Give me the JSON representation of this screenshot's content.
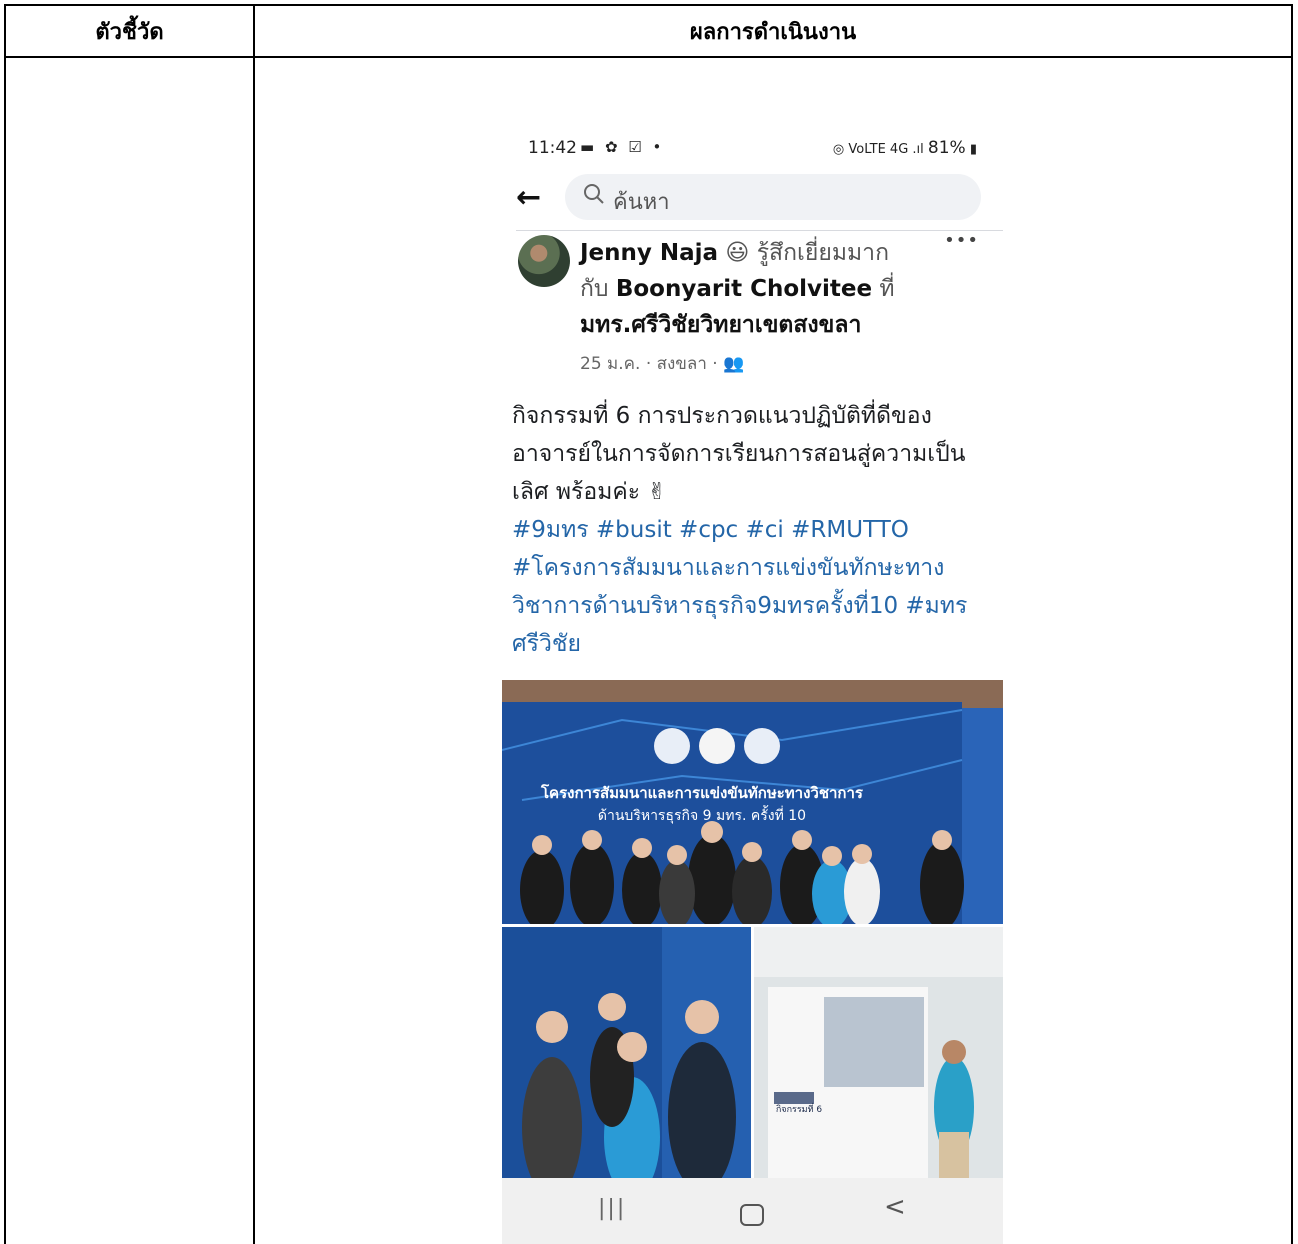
{
  "table": {
    "col1_header": "ตัวชี้วัด",
    "col2_header": "ผลการดำเนินงาน"
  },
  "status_bar": {
    "time": "11:42",
    "left_icons": "▬ ✿ ☑ •",
    "right_icons": "◎ VoLTE 4G .ıl",
    "battery": "81%"
  },
  "search": {
    "placeholder": "ค้นหา"
  },
  "post": {
    "author": "Jenny Naja",
    "feeling": "รู้สึกเยี่ยมมาก",
    "with_label": "กับ",
    "tagged": "Boonyarit Cholvitee",
    "at_label": "ที่",
    "place": "มทร.ศรีวิชัยวิทยาเขตสงขลา",
    "meta": "25 ม.ค. · สงขลา · 👥",
    "text": "กิจกรรมที่ 6 การประกวดแนวปฏิบัติที่ดีของอาจารย์ในการจัดการเรียนการสอนสู่ความเป็นเลิศ พร้อมค่ะ ✌",
    "hashtags": "#9มทร #busit #cpc #ci #RMUTTO #โครงการสัมมนาและการแข่งขันทักษะทางวิชาการด้านบริหารธุรกิจ9มทรครั้งที่10 #มทรศรีวิชัย"
  },
  "photos": {
    "banner_line1": "โครงการสัมมนาและการแข่งขันทักษะทางวิชาการ",
    "banner_line2": "ด้านบริหารธุรกิจ 9 มทร. ครั้งที่ 10",
    "poster_label": "กิจกรรมที่ 6"
  },
  "navbar": {
    "recents": "|||",
    "back": "<"
  },
  "colors": {
    "link": "#2466a8",
    "search_bg": "#f0f2f5",
    "stage_blue": "#1d4f9c"
  }
}
